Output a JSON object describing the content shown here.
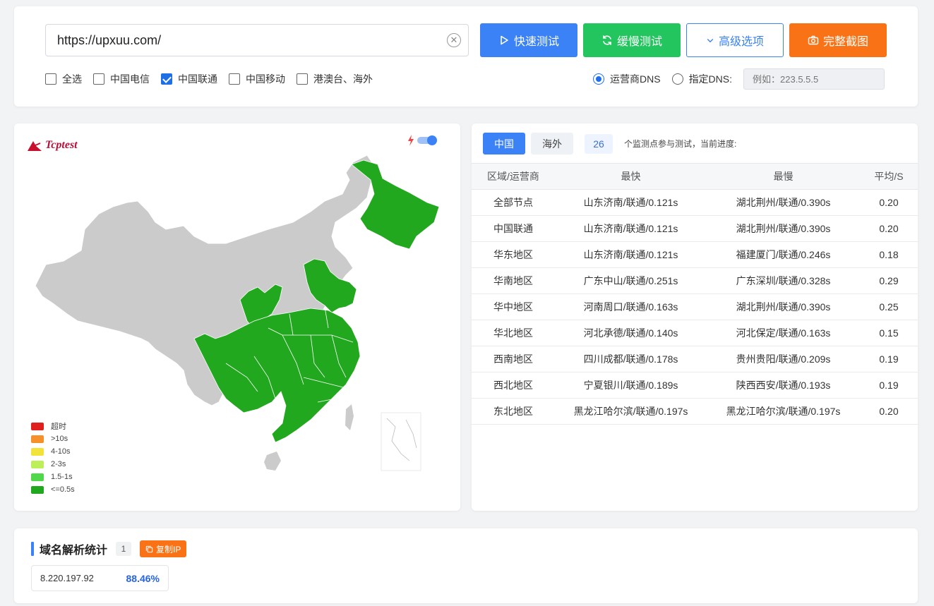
{
  "search": {
    "url_value": "https://upxuu.com/"
  },
  "buttons": {
    "fast": "快速测试",
    "slow": "缓慢测试",
    "advanced": "高级选项",
    "screenshot": "完整截图"
  },
  "isp_filters": [
    {
      "label": "全选",
      "checked": false
    },
    {
      "label": "中国电信",
      "checked": false
    },
    {
      "label": "中国联通",
      "checked": true
    },
    {
      "label": "中国移动",
      "checked": false
    },
    {
      "label": "港澳台、海外",
      "checked": false
    }
  ],
  "dns": {
    "isp_dns_label": "运营商DNS",
    "custom_dns_label": "指定DNS:",
    "custom_dns_placeholder": "例如：223.5.5.5",
    "selected": "isp"
  },
  "map": {
    "logo_text": "Tcptest",
    "legend": [
      {
        "label": "超时",
        "color": "#e0201c"
      },
      {
        "label": ">10s",
        "color": "#f5902a"
      },
      {
        "label": "4-10s",
        "color": "#f2e33a"
      },
      {
        "label": "2-3s",
        "color": "#bcef5a"
      },
      {
        "label": "1.5-1s",
        "color": "#4ed84a"
      },
      {
        "label": "<=0.5s",
        "color": "#22a81e"
      }
    ],
    "land_color": "#cbcbcb",
    "result_color": "#22a81e"
  },
  "stats": {
    "tab_china": "中国",
    "tab_overseas": "海外",
    "node_count": "26",
    "progress_text": "个监测点参与测试，当前进度:",
    "columns": [
      "区域/运营商",
      "最快",
      "最慢",
      "平均/S"
    ],
    "rows": [
      [
        "全部节点",
        "山东济南/联通/0.121s",
        "湖北荆州/联通/0.390s",
        "0.20"
      ],
      [
        "中国联通",
        "山东济南/联通/0.121s",
        "湖北荆州/联通/0.390s",
        "0.20"
      ],
      [
        "华东地区",
        "山东济南/联通/0.121s",
        "福建厦门/联通/0.246s",
        "0.18"
      ],
      [
        "华南地区",
        "广东中山/联通/0.251s",
        "广东深圳/联通/0.328s",
        "0.29"
      ],
      [
        "华中地区",
        "河南周口/联通/0.163s",
        "湖北荆州/联通/0.390s",
        "0.25"
      ],
      [
        "华北地区",
        "河北承德/联通/0.140s",
        "河北保定/联通/0.163s",
        "0.15"
      ],
      [
        "西南地区",
        "四川成都/联通/0.178s",
        "贵州贵阳/联通/0.209s",
        "0.19"
      ],
      [
        "西北地区",
        "宁夏银川/联通/0.189s",
        "陕西西安/联通/0.193s",
        "0.19"
      ],
      [
        "东北地区",
        "黑龙江哈尔滨/联通/0.197s",
        "黑龙江哈尔滨/联通/0.197s",
        "0.20"
      ]
    ]
  },
  "dns_stats": {
    "title": "域名解析统计",
    "count": "1",
    "copy_label": "复制IP",
    "entries": [
      {
        "ip": "8.220.197.92",
        "percent": "88.46%"
      }
    ]
  }
}
